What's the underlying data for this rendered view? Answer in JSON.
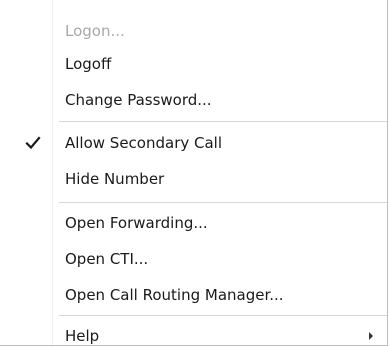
{
  "menu": {
    "items": [
      {
        "label": "Logon...",
        "enabled": false,
        "checked": false
      },
      {
        "label": "Logoff",
        "enabled": true,
        "checked": false
      },
      {
        "label": "Change Password...",
        "enabled": true,
        "checked": false
      },
      {
        "label": "Allow Secondary Call",
        "enabled": true,
        "checked": true,
        "icon": "checkmark-icon"
      },
      {
        "label": "Hide Number",
        "enabled": true,
        "checked": false
      },
      {
        "label": "Open Forwarding...",
        "enabled": true,
        "checked": false
      },
      {
        "label": "Open CTI...",
        "enabled": true,
        "checked": false
      },
      {
        "label": "Open Call Routing Manager...",
        "enabled": true,
        "checked": false
      },
      {
        "label": "Help",
        "enabled": true,
        "checked": false,
        "submenu": true,
        "icon": "submenu-arrow-icon"
      }
    ]
  }
}
